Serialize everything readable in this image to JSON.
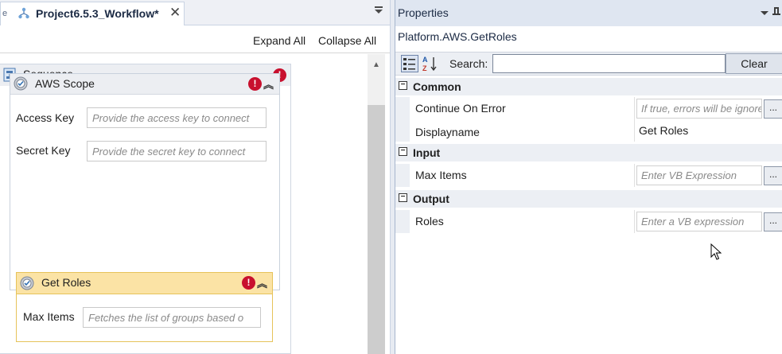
{
  "designer": {
    "tab_lead": "e",
    "tab_title": "Project6.5.3_Workflow*",
    "close_glyph": "✕",
    "expand_all": "Expand All",
    "collapse_all": "Collapse All",
    "sequence": {
      "label": "Sequence",
      "error_glyph": "!"
    },
    "aws_scope": {
      "label": "AWS Scope",
      "collapse_glyph": "︽",
      "error_glyph": "!",
      "fields": [
        {
          "label": "Access Key",
          "placeholder": "Provide the access key to connect"
        },
        {
          "label": "Secret Key",
          "placeholder": "Provide the secret key to connect"
        }
      ]
    },
    "get_roles": {
      "label": "Get Roles",
      "collapse_glyph": "︽",
      "error_glyph": "!",
      "field_label": "Max Items",
      "field_placeholder": "Fetches the list of groups based o"
    },
    "icons": {
      "workflow": "workflow-icon",
      "sequence": "sequence-icon",
      "activity": "gear-icon",
      "error": "error-icon"
    }
  },
  "properties": {
    "title": "Properties",
    "activity_name": "Platform.AWS.GetRoles",
    "search_label": "Search:",
    "search_value": "",
    "clear_label": "Clear",
    "categories": [
      {
        "name": "Common",
        "toggle": "−",
        "rows": [
          {
            "name": "Continue On Error",
            "value": "If true, errors will be ignored",
            "placeholder": true,
            "ellipsis": "..."
          },
          {
            "name": "Displayname",
            "value": "Get Roles",
            "placeholder": false,
            "ellipsis": ""
          }
        ]
      },
      {
        "name": "Input",
        "toggle": "−",
        "rows": [
          {
            "name": "Max Items",
            "value": "Enter VB Expression",
            "placeholder": true,
            "ellipsis": "..."
          }
        ]
      },
      {
        "name": "Output",
        "toggle": "−",
        "rows": [
          {
            "name": "Roles",
            "value": "Enter a VB expression",
            "placeholder": true,
            "ellipsis": "..."
          }
        ]
      }
    ]
  },
  "colors": {
    "error_red": "#c8102e",
    "selected_activity_header": "#fbe3a5",
    "selected_activity_border": "#e6c35a",
    "panel_header": "#dfe6f1"
  }
}
